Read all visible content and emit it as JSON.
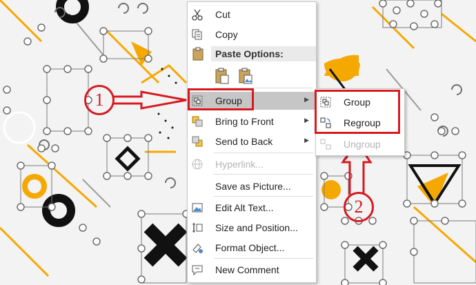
{
  "context_menu": {
    "items": [
      {
        "label": "Cut",
        "icon": "scissors-icon"
      },
      {
        "label": "Copy",
        "icon": "copy-icon"
      },
      {
        "label": "Paste Options:",
        "icon": "clipboard-icon"
      },
      {
        "label": "Group",
        "icon": "group-icon",
        "has_submenu": true,
        "highlighted": true
      },
      {
        "label": "Bring to Front",
        "icon": "bring-to-front-icon",
        "has_submenu": true
      },
      {
        "label": "Send to Back",
        "icon": "send-to-back-icon",
        "has_submenu": true
      },
      {
        "label": "Hyperlink...",
        "icon": "hyperlink-icon",
        "disabled": true
      },
      {
        "label": "Save as Picture...",
        "icon": ""
      },
      {
        "label": "Edit Alt Text...",
        "icon": "alt-text-icon"
      },
      {
        "label": "Size and Position...",
        "icon": "size-position-icon"
      },
      {
        "label": "Format Object...",
        "icon": "format-object-icon"
      },
      {
        "label": "New Comment",
        "icon": "new-comment-icon"
      }
    ]
  },
  "group_submenu": {
    "items": [
      {
        "label": "Group",
        "icon": "group-icon"
      },
      {
        "label": "Regroup",
        "icon": "regroup-icon"
      },
      {
        "label": "Ungroup",
        "icon": "ungroup-icon",
        "disabled": true
      }
    ]
  },
  "annotations": {
    "step_1": "1",
    "step_2": "2",
    "color": "#d71920"
  },
  "colors": {
    "accent_orange": "#f5a800",
    "highlight": "#c6c6c6",
    "annotation_red": "#d71920"
  }
}
